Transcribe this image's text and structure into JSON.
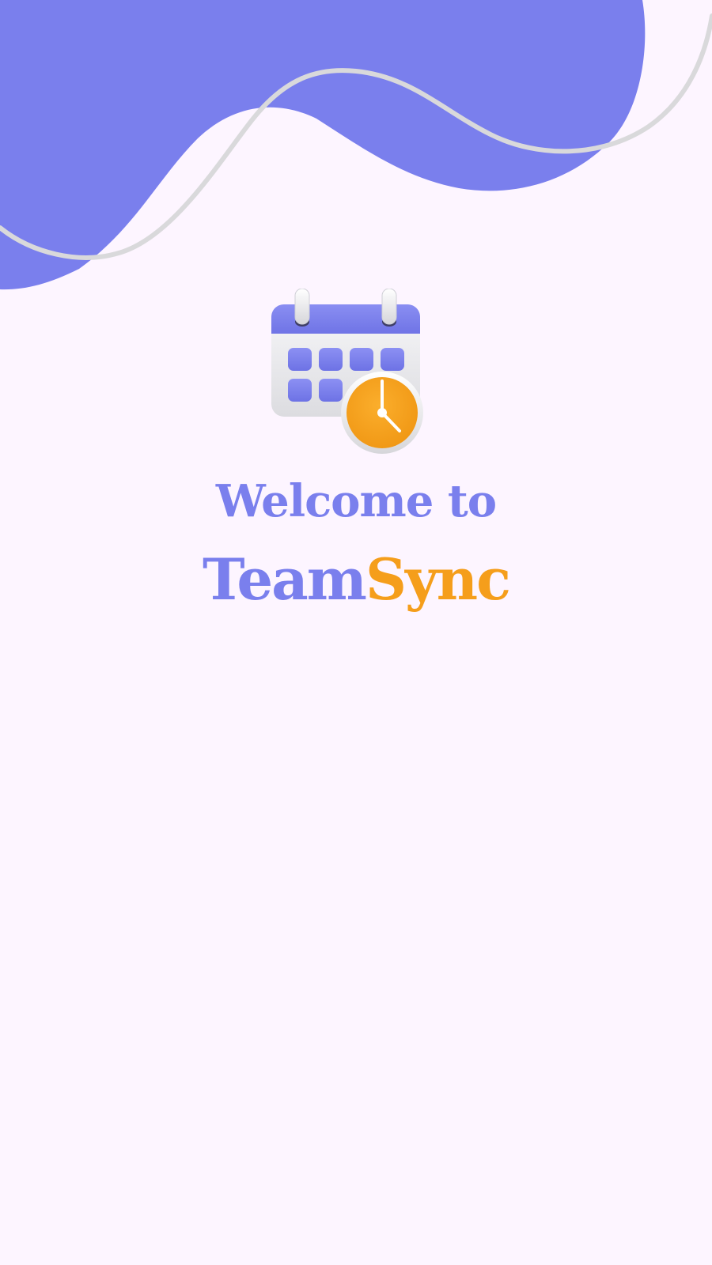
{
  "colors": {
    "background": "#FDF5FF",
    "primary": "#7A7FED",
    "accent": "#F59E1B",
    "wave_line": "#D9D9DB"
  },
  "splash": {
    "welcome_text": "Welcome to",
    "brand_part1": "Team",
    "brand_part2": "Sync"
  },
  "icons": {
    "logo": "calendar-clock-icon",
    "background": "wave-shape"
  }
}
